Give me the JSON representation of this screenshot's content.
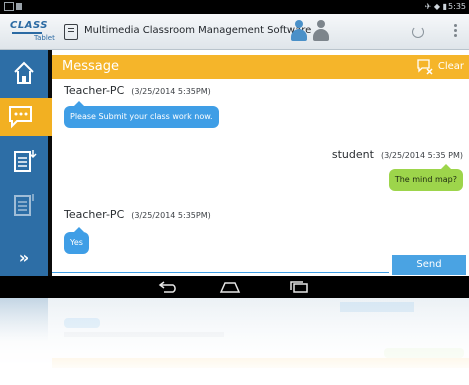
{
  "status_bar": {
    "time": "5:35"
  },
  "app": {
    "logo_word": "CLASS",
    "logo_sub": "Tablet",
    "title": "Multimedia Classroom Management Software"
  },
  "panel": {
    "title": "Message",
    "clear_label": "Clear",
    "send_label": "Send",
    "input_value": ""
  },
  "messages": [
    {
      "author": "Teacher-PC",
      "timestamp": "(3/25/2014 5:35PM)",
      "text": "Please Submit your class work now."
    },
    {
      "author": "student",
      "timestamp": "(3/25/2014 5:35 PM)",
      "text": "The mind map?"
    },
    {
      "author": "Teacher-PC",
      "timestamp": "(3/25/2014 5:35PM)",
      "text": "Yes"
    }
  ],
  "rail": {
    "more_label": "»"
  },
  "colors": {
    "rail": "#2d6ea6",
    "accent_orange": "#f5b52a",
    "bubble_blue": "#3f9ee6",
    "bubble_green": "#9dd54b",
    "send_button": "#4aa3e3"
  }
}
